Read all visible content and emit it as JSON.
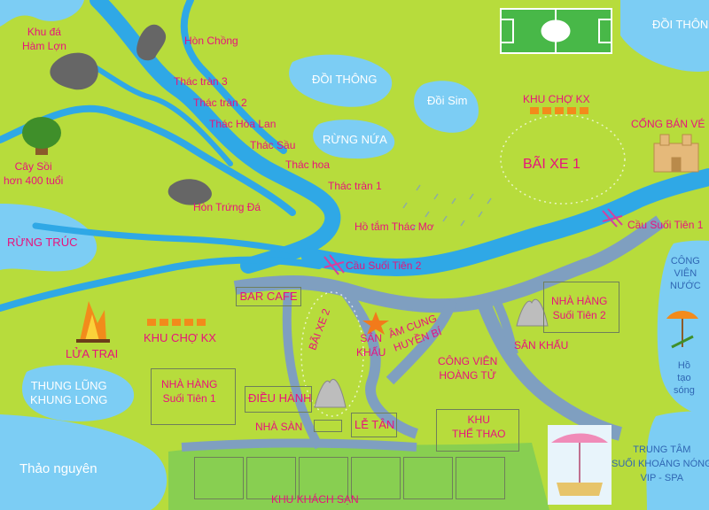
{
  "map": {
    "labels": {
      "khu_da_ham_lon": "Khu đá\nHàm Lợn",
      "hon_chong": "Hòn Chồng",
      "thac_tran_3": "Thác tràn 3",
      "thac_tran_2": "Thác tràn 2",
      "thac_hoa_lan": "Thác Hòa Lan",
      "thac_sau": "Thác Sầu",
      "thac_hoa": "Thác hoa",
      "thac_tran_1": "Thác tràn 1",
      "cay_soi": "Cây Sồi\nhơn 400 tuổi",
      "hon_trung_da": "Hòn Trứng Đá",
      "doi_thong": "ĐỒI THÔNG",
      "doi_thong_right": "ĐỒI THÔNG",
      "doi_sim": "Đồi Sim",
      "rung_nua": "RỪNG NỨA",
      "rung_truc": "RỪNG TRÚC",
      "khu_cho_kx_top": "KHU CHỢ KX",
      "bai_xe_1": "BÃI XE 1",
      "cong_ban_ve": "CỔNG BÁN VÉ",
      "cau_suoi_tien_1": "Cầu Suối Tiên 1",
      "ho_tam_thac_mo": "Hồ tắm Thác Mơ",
      "cau_suoi_tien_2": "Cầu Suối Tiên 2",
      "cong_vien_nuoc": "CÔNG\nVIÊN\nNƯỚC",
      "ho_tao_song": "Hồ\ntạo\nsóng",
      "bar_cafe": "BAR CAFE",
      "bai_xe_2": "BÃI XE 2",
      "san_khau_left": "SÂN\nKHẤU",
      "am_cung_huyen_bi": "ÂM CUNG\nHUYỀN BÍ",
      "san_khau_right": "SÂN KHẤU",
      "nha_hang_suoi_tien_2": "NHÀ HÀNG\nSuối Tiên 2",
      "cong_vien_hoang_tu": "CÔNG VIÊN\nHOÀNG TỬ",
      "lua_trai": "LỬA TRẠI",
      "khu_cho_kx_left": "KHU CHỢ KX",
      "nha_hang_suoi_tien_1": "NHÀ HÀNG\nSuối Tiên 1",
      "thung_lung_khung_long": "THUNG LŨNG\nKHUNG LONG",
      "dieu_hanh": "ĐIỀU HÀNH",
      "nha_san": "NHÀ SÀN",
      "le_tan": "LỄ TÂN",
      "khu_the_thao": "KHU\nTHỂ THAO",
      "thao_nguyen": "Thảo nguyên",
      "khu_khach_san": "KHU KHÁCH SẠN",
      "trung_tam": "TRUNG TÂM\nSUỐI KHOÁNG NÓNG\nVIP - SPA"
    },
    "colors": {
      "grass": "#b7dc3c",
      "river": "#2fa8e6",
      "lake": "#7ccdf4",
      "road": "#7f9fc0",
      "label_pink": "#e8127c"
    },
    "icons": [
      "soccer-field-icon",
      "rock-icon",
      "tree-icon",
      "campfire-icon",
      "stage-icon",
      "star-icon",
      "castle-icon",
      "bridge-icon",
      "beach-umbrella-icon",
      "spa-icon"
    ]
  }
}
